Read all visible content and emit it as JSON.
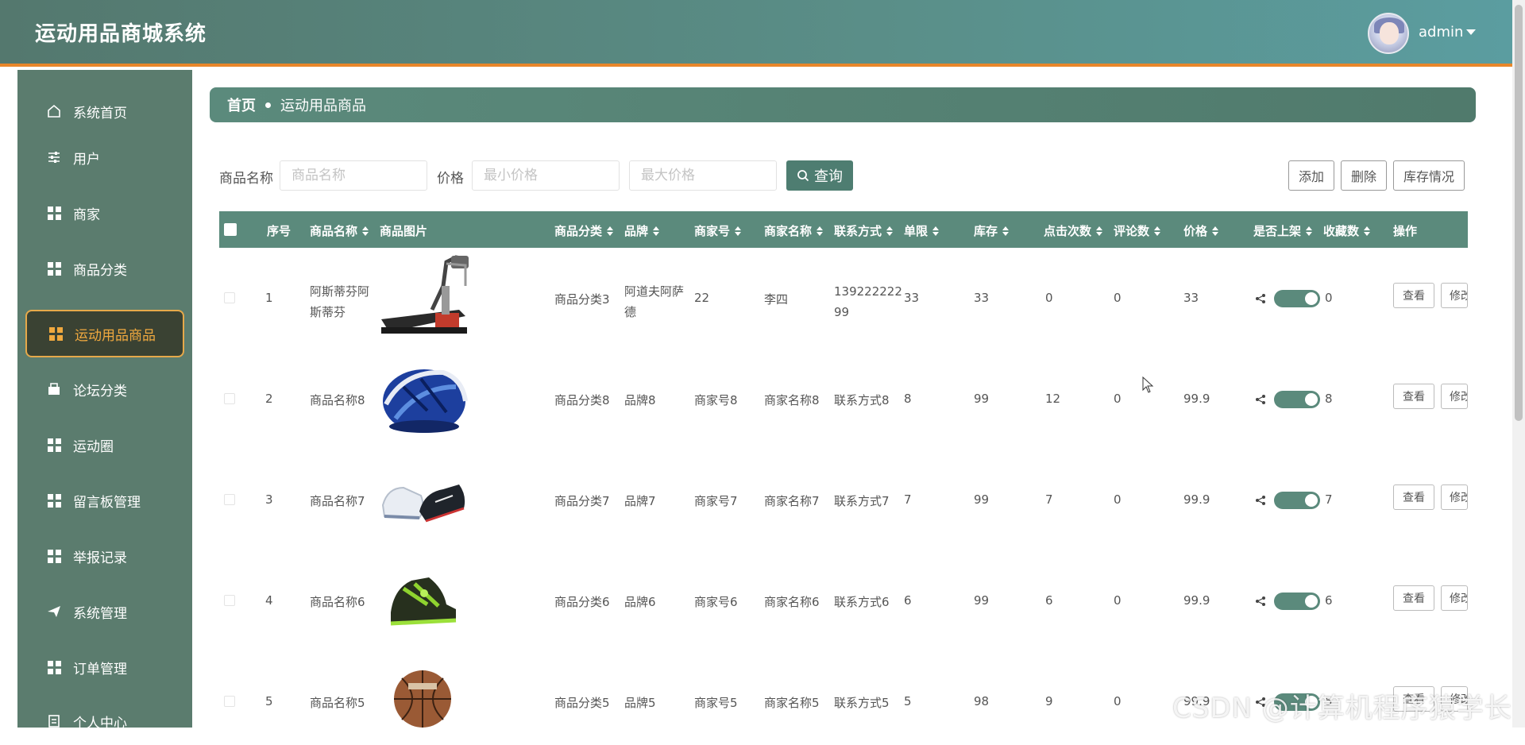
{
  "app": {
    "title": "运动用品商城系统",
    "user": "admin"
  },
  "sidebar": {
    "items": [
      {
        "label": "系统首页",
        "icon": "home-icon"
      },
      {
        "label": "用户",
        "icon": "sliders-icon"
      },
      {
        "label": "商家",
        "icon": "grid-icon"
      },
      {
        "label": "商品分类",
        "icon": "grid-icon"
      },
      {
        "label": "运动用品商品",
        "icon": "grid-icon",
        "active": true
      },
      {
        "label": "论坛分类",
        "icon": "bookmark-icon"
      },
      {
        "label": "运动圈",
        "icon": "grid-icon"
      },
      {
        "label": "留言板管理",
        "icon": "grid-icon"
      },
      {
        "label": "举报记录",
        "icon": "grid-icon"
      },
      {
        "label": "系统管理",
        "icon": "send-icon"
      },
      {
        "label": "订单管理",
        "icon": "grid-icon"
      },
      {
        "label": "个人中心",
        "icon": "document-icon"
      }
    ]
  },
  "breadcrumb": {
    "home": "首页",
    "current": "运动用品商品"
  },
  "search": {
    "name_label": "商品名称",
    "name_placeholder": "商品名称",
    "price_label": "价格",
    "min_placeholder": "最小价格",
    "max_placeholder": "最大价格",
    "query_label": "查询"
  },
  "toolbar": {
    "add": "添加",
    "delete": "删除",
    "stock": "库存情况"
  },
  "table": {
    "headers": {
      "index": "序号",
      "name": "商品名称",
      "image": "商品图片",
      "category": "商品分类",
      "brand": "品牌",
      "merchant_no": "商家号",
      "merchant_name": "商家名称",
      "contact": "联系方式",
      "limit": "单限",
      "stock": "库存",
      "clicks": "点击次数",
      "comments": "评论数",
      "price": "价格",
      "on_shelf": "是否上架",
      "favorites": "收藏数",
      "actions": "操作"
    },
    "rows": [
      {
        "index": "1",
        "name_line1": "阿斯蒂芬阿",
        "name_line2": "斯蒂芬",
        "image": "treadmill",
        "category": "商品分类3",
        "brand_line1": "阿道夫阿萨",
        "brand_line2": "德",
        "merchant_no": "22",
        "merchant_name": "李四",
        "contact_line1": "139222222",
        "contact_line2": "99",
        "limit": "33",
        "stock": "33",
        "clicks": "0",
        "comments": "0",
        "price": "33",
        "favorites": "0",
        "on_shelf": true
      },
      {
        "index": "2",
        "name_line1": "商品名称8",
        "name_line2": "",
        "image": "helmet",
        "category": "商品分类8",
        "brand_line1": "品牌8",
        "brand_line2": "",
        "merchant_no": "商家号8",
        "merchant_name": "商家名称8",
        "contact_line1": "联系方式8",
        "contact_line2": "",
        "limit": "8",
        "stock": "99",
        "clicks": "12",
        "comments": "0",
        "price": "99.9",
        "favorites": "8",
        "on_shelf": true
      },
      {
        "index": "3",
        "name_line1": "商品名称7",
        "name_line2": "",
        "image": "sneakers",
        "category": "商品分类7",
        "brand_line1": "品牌7",
        "brand_line2": "",
        "merchant_no": "商家号7",
        "merchant_name": "商家名称7",
        "contact_line1": "联系方式7",
        "contact_line2": "",
        "limit": "7",
        "stock": "99",
        "clicks": "7",
        "comments": "0",
        "price": "99.9",
        "favorites": "7",
        "on_shelf": true
      },
      {
        "index": "4",
        "name_line1": "商品名称6",
        "name_line2": "",
        "image": "basketball-shoe",
        "category": "商品分类6",
        "brand_line1": "品牌6",
        "brand_line2": "",
        "merchant_no": "商家号6",
        "merchant_name": "商家名称6",
        "contact_line1": "联系方式6",
        "contact_line2": "",
        "limit": "6",
        "stock": "99",
        "clicks": "6",
        "comments": "0",
        "price": "99.9",
        "favorites": "6",
        "on_shelf": true
      },
      {
        "index": "5",
        "name_line1": "商品名称5",
        "name_line2": "",
        "image": "basketball",
        "category": "商品分类5",
        "brand_line1": "品牌5",
        "brand_line2": "",
        "merchant_no": "商家号5",
        "merchant_name": "商家名称5",
        "contact_line1": "联系方式5",
        "contact_line2": "",
        "limit": "5",
        "stock": "98",
        "clicks": "9",
        "comments": "0",
        "price": "99.9",
        "favorites": "5",
        "on_shelf": true
      }
    ],
    "row_actions": {
      "view": "查看",
      "edit": "修改"
    }
  },
  "watermark": "CSDN @计算机程序猿学长",
  "colors": {
    "header": "#5a8f89",
    "sidebar": "#5b7c6e",
    "accent": "#e8862a",
    "table_head": "#5b8a7c",
    "active_text": "#f0a93f"
  }
}
